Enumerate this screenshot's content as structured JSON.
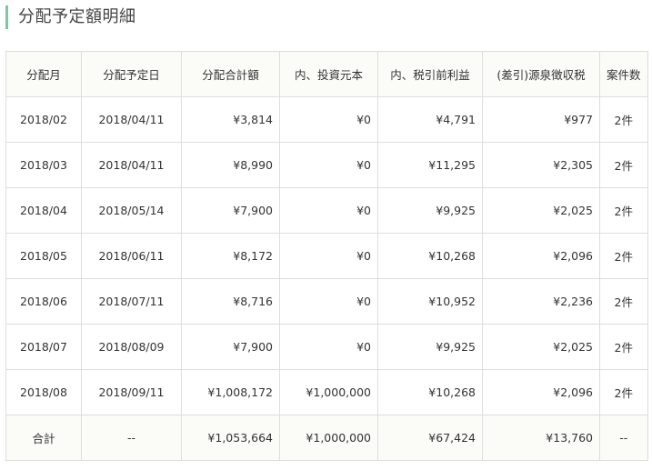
{
  "title": "分配予定額明細",
  "table": {
    "headers": [
      "分配月",
      "分配予定日",
      "分配合計額",
      "内、投資元本",
      "内、税引前利益",
      "(差引)源泉徴収税",
      "案件数"
    ],
    "rows": [
      [
        "2018/02",
        "2018/04/11",
        "¥3,814",
        "¥0",
        "¥4,791",
        "¥977",
        "2件"
      ],
      [
        "2018/03",
        "2018/04/11",
        "¥8,990",
        "¥0",
        "¥11,295",
        "¥2,305",
        "2件"
      ],
      [
        "2018/04",
        "2018/05/14",
        "¥7,900",
        "¥0",
        "¥9,925",
        "¥2,025",
        "2件"
      ],
      [
        "2018/05",
        "2018/06/11",
        "¥8,172",
        "¥0",
        "¥10,268",
        "¥2,096",
        "2件"
      ],
      [
        "2018/06",
        "2018/07/11",
        "¥8,716",
        "¥0",
        "¥10,952",
        "¥2,236",
        "2件"
      ],
      [
        "2018/07",
        "2018/08/09",
        "¥7,900",
        "¥0",
        "¥9,925",
        "¥2,025",
        "2件"
      ],
      [
        "2018/08",
        "2018/09/11",
        "¥1,008,172",
        "¥1,000,000",
        "¥10,268",
        "¥2,096",
        "2件"
      ]
    ],
    "total": [
      "合計",
      "--",
      "¥1,053,664",
      "¥1,000,000",
      "¥67,424",
      "¥13,760",
      "--"
    ]
  },
  "colors": {
    "accent": "#7fc7a3",
    "header_bg": "#fbfbf8",
    "border": "#dddddd"
  }
}
